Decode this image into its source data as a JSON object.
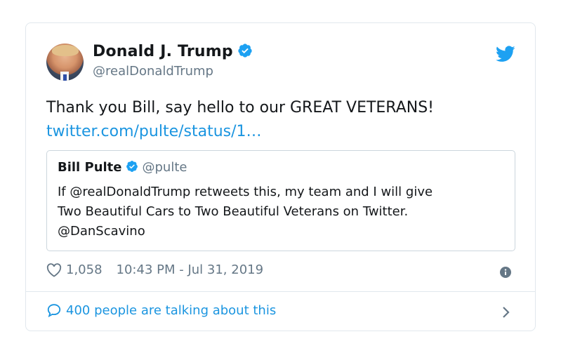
{
  "author": {
    "name": "Donald J. Trump",
    "handle": "@realDonaldTrump",
    "verified": true
  },
  "tweet": {
    "text": "Thank you Bill, say hello to our GREAT VETERANS!",
    "link": "twitter.com/pulte/status/1…"
  },
  "quoted": {
    "name": "Bill Pulte",
    "handle": "@pulte",
    "lines": [
      "If @realDonaldTrump retweets this, my team and I will give",
      "Two Beautiful Cars to Two Beautiful Veterans on Twitter.",
      "@DanScavino"
    ]
  },
  "meta": {
    "likes": "1,058",
    "timestamp": "10:43 PM - Jul 31, 2019"
  },
  "footer": {
    "talking": "400 people are talking about this"
  },
  "icons": {
    "verified": "verified-badge-icon",
    "bird": "twitter-bird-icon",
    "heart": "heart-icon",
    "info": "info-icon",
    "comment": "speech-bubble-icon",
    "chevron": "chevron-right-icon"
  },
  "colors": {
    "link": "#1b95e0",
    "text": "#14171a",
    "muted": "#657786",
    "border": "#e1e8ed"
  }
}
